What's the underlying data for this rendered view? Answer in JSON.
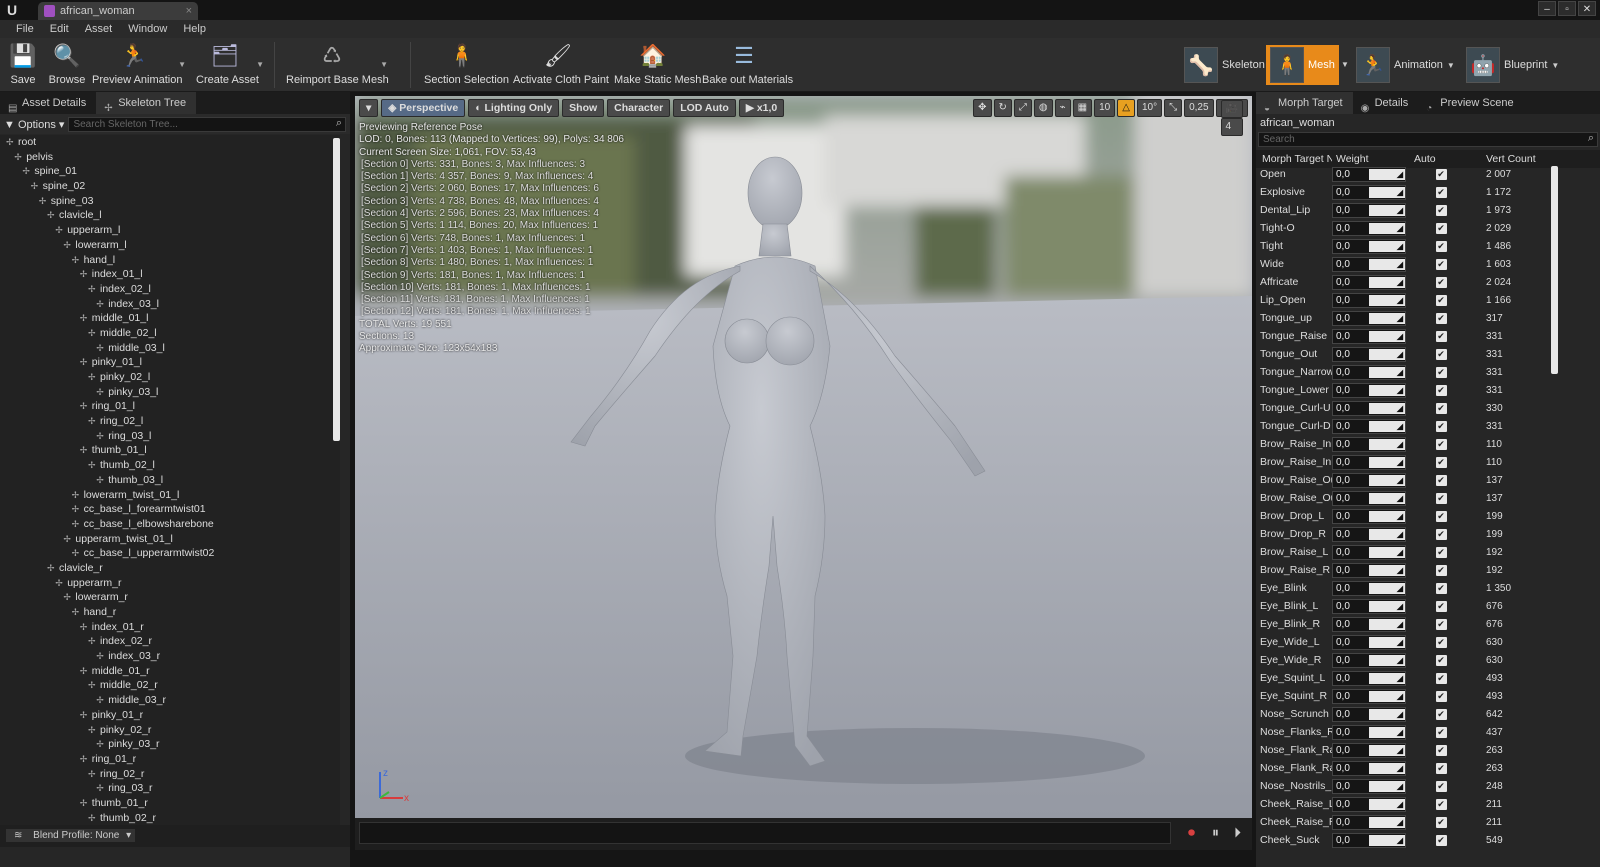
{
  "window": {
    "tab_title": "african_woman",
    "logo": "U"
  },
  "menu": [
    "File",
    "Edit",
    "Asset",
    "Window",
    "Help"
  ],
  "toolbar": {
    "save": "Save",
    "browse": "Browse",
    "preview_animation": "Preview Animation",
    "create_asset": "Create Asset",
    "reimport": "Reimport Base Mesh",
    "section_selection": "Section Selection",
    "activate_cloth": "Activate Cloth Paint",
    "make_static": "Make Static Mesh",
    "bake_materials": "Bake out Materials"
  },
  "modes": {
    "skeleton": "Skeleton",
    "mesh": "Mesh",
    "animation": "Animation",
    "blueprint": "Blueprint"
  },
  "left_panel": {
    "tab_asset_details": "Asset Details",
    "tab_skeleton_tree": "Skeleton Tree",
    "options": "Options",
    "search_placeholder": "Search Skeleton Tree...",
    "blend_profile": "Blend Profile: None",
    "bones": [
      {
        "name": "root",
        "depth": 0
      },
      {
        "name": "pelvis",
        "depth": 1
      },
      {
        "name": "spine_01",
        "depth": 2
      },
      {
        "name": "spine_02",
        "depth": 3
      },
      {
        "name": "spine_03",
        "depth": 4
      },
      {
        "name": "clavicle_l",
        "depth": 5
      },
      {
        "name": "upperarm_l",
        "depth": 6
      },
      {
        "name": "lowerarm_l",
        "depth": 7
      },
      {
        "name": "hand_l",
        "depth": 8
      },
      {
        "name": "index_01_l",
        "depth": 9
      },
      {
        "name": "index_02_l",
        "depth": 10
      },
      {
        "name": "index_03_l",
        "depth": 11
      },
      {
        "name": "middle_01_l",
        "depth": 9
      },
      {
        "name": "middle_02_l",
        "depth": 10
      },
      {
        "name": "middle_03_l",
        "depth": 11
      },
      {
        "name": "pinky_01_l",
        "depth": 9
      },
      {
        "name": "pinky_02_l",
        "depth": 10
      },
      {
        "name": "pinky_03_l",
        "depth": 11
      },
      {
        "name": "ring_01_l",
        "depth": 9
      },
      {
        "name": "ring_02_l",
        "depth": 10
      },
      {
        "name": "ring_03_l",
        "depth": 11
      },
      {
        "name": "thumb_01_l",
        "depth": 9
      },
      {
        "name": "thumb_02_l",
        "depth": 10
      },
      {
        "name": "thumb_03_l",
        "depth": 11
      },
      {
        "name": "lowerarm_twist_01_l",
        "depth": 8
      },
      {
        "name": "cc_base_l_forearmtwist01",
        "depth": 8
      },
      {
        "name": "cc_base_l_elbowsharebone",
        "depth": 8
      },
      {
        "name": "upperarm_twist_01_l",
        "depth": 7
      },
      {
        "name": "cc_base_l_upperarmtwist02",
        "depth": 8
      },
      {
        "name": "clavicle_r",
        "depth": 5
      },
      {
        "name": "upperarm_r",
        "depth": 6
      },
      {
        "name": "lowerarm_r",
        "depth": 7
      },
      {
        "name": "hand_r",
        "depth": 8
      },
      {
        "name": "index_01_r",
        "depth": 9
      },
      {
        "name": "index_02_r",
        "depth": 10
      },
      {
        "name": "index_03_r",
        "depth": 11
      },
      {
        "name": "middle_01_r",
        "depth": 9
      },
      {
        "name": "middle_02_r",
        "depth": 10
      },
      {
        "name": "middle_03_r",
        "depth": 11
      },
      {
        "name": "pinky_01_r",
        "depth": 9
      },
      {
        "name": "pinky_02_r",
        "depth": 10
      },
      {
        "name": "pinky_03_r",
        "depth": 11
      },
      {
        "name": "ring_01_r",
        "depth": 9
      },
      {
        "name": "ring_02_r",
        "depth": 10
      },
      {
        "name": "ring_03_r",
        "depth": 11
      },
      {
        "name": "thumb_01_r",
        "depth": 9
      },
      {
        "name": "thumb_02_r",
        "depth": 10
      }
    ]
  },
  "viewport": {
    "perspective": "Perspective",
    "lighting": "Lighting Only",
    "show": "Show",
    "character": "Character",
    "lod": "LOD Auto",
    "speed": "x1,0",
    "grid": "10",
    "angle": "10°",
    "scale": "0,25",
    "camspeed": "4",
    "stats": [
      "Previewing Reference Pose",
      "LOD: 0, Bones: 113 (Mapped to Vertices: 99), Polys: 34 806",
      "Current Screen Size: 1,061, FOV: 53,43",
      "[Section 0] Verts: 331, Bones: 3, Max Influences: 3",
      "[Section 1] Verts: 4 357, Bones: 9, Max Influences: 4",
      "[Section 2] Verts: 2 060, Bones: 17, Max Influences: 6",
      "[Section 3] Verts: 4 738, Bones: 48, Max Influences: 4",
      "[Section 4] Verts: 2 596, Bones: 23, Max Influences: 4",
      "[Section 5] Verts: 1 114, Bones: 20, Max Influences: 1",
      "[Section 6] Verts: 748, Bones: 1, Max Influences: 1",
      "[Section 7] Verts: 1 403, Bones: 1, Max Influences: 1",
      "[Section 8] Verts: 1 480, Bones: 1, Max Influences: 1",
      "[Section 9] Verts: 181, Bones: 1, Max Influences: 1",
      "[Section 10] Verts: 181, Bones: 1, Max Influences: 1",
      "[Section 11] Verts: 181, Bones: 1, Max Influences: 1",
      "[Section 12] Verts: 181, Bones: 1, Max Influences: 1",
      "TOTAL Verts: 19 551",
      "Sections: 13",
      "Approximate Size: 123x54x183"
    ],
    "axis_x": "x",
    "axis_z": "z"
  },
  "right_panel": {
    "tab_morph": "Morph Target",
    "tab_details": "Details",
    "tab_preview": "Preview Scene",
    "asset_name": "african_woman",
    "search_placeholder": "Search",
    "col_name": "Morph Target N",
    "col_weight": "Weight",
    "col_auto": "Auto",
    "col_vert": "Vert Count",
    "rows": [
      {
        "name": "Open",
        "weight": "0,0",
        "vc": "2 007"
      },
      {
        "name": "Explosive",
        "weight": "0,0",
        "vc": "1 172"
      },
      {
        "name": "Dental_Lip",
        "weight": "0,0",
        "vc": "1 973"
      },
      {
        "name": "Tight-O",
        "weight": "0,0",
        "vc": "2 029"
      },
      {
        "name": "Tight",
        "weight": "0,0",
        "vc": "1 486"
      },
      {
        "name": "Wide",
        "weight": "0,0",
        "vc": "1 603"
      },
      {
        "name": "Affricate",
        "weight": "0,0",
        "vc": "2 024"
      },
      {
        "name": "Lip_Open",
        "weight": "0,0",
        "vc": "1 166"
      },
      {
        "name": "Tongue_up",
        "weight": "0,0",
        "vc": "317"
      },
      {
        "name": "Tongue_Raise",
        "weight": "0,0",
        "vc": "331"
      },
      {
        "name": "Tongue_Out",
        "weight": "0,0",
        "vc": "331"
      },
      {
        "name": "Tongue_Narrow",
        "weight": "0,0",
        "vc": "331"
      },
      {
        "name": "Tongue_Lower",
        "weight": "0,0",
        "vc": "331"
      },
      {
        "name": "Tongue_Curl-U",
        "weight": "0,0",
        "vc": "330"
      },
      {
        "name": "Tongue_Curl-D",
        "weight": "0,0",
        "vc": "331"
      },
      {
        "name": "Brow_Raise_Inn",
        "weight": "0,0",
        "vc": "110"
      },
      {
        "name": "Brow_Raise_Inn",
        "weight": "0,0",
        "vc": "110"
      },
      {
        "name": "Brow_Raise_Out",
        "weight": "0,0",
        "vc": "137"
      },
      {
        "name": "Brow_Raise_Out",
        "weight": "0,0",
        "vc": "137"
      },
      {
        "name": "Brow_Drop_L",
        "weight": "0,0",
        "vc": "199"
      },
      {
        "name": "Brow_Drop_R",
        "weight": "0,0",
        "vc": "199"
      },
      {
        "name": "Brow_Raise_L",
        "weight": "0,0",
        "vc": "192"
      },
      {
        "name": "Brow_Raise_R",
        "weight": "0,0",
        "vc": "192"
      },
      {
        "name": "Eye_Blink",
        "weight": "0,0",
        "vc": "1 350"
      },
      {
        "name": "Eye_Blink_L",
        "weight": "0,0",
        "vc": "676"
      },
      {
        "name": "Eye_Blink_R",
        "weight": "0,0",
        "vc": "676"
      },
      {
        "name": "Eye_Wide_L",
        "weight": "0,0",
        "vc": "630"
      },
      {
        "name": "Eye_Wide_R",
        "weight": "0,0",
        "vc": "630"
      },
      {
        "name": "Eye_Squint_L",
        "weight": "0,0",
        "vc": "493"
      },
      {
        "name": "Eye_Squint_R",
        "weight": "0,0",
        "vc": "493"
      },
      {
        "name": "Nose_Scrunch",
        "weight": "0,0",
        "vc": "642"
      },
      {
        "name": "Nose_Flanks_Ra",
        "weight": "0,0",
        "vc": "437"
      },
      {
        "name": "Nose_Flank_Rai",
        "weight": "0,0",
        "vc": "263"
      },
      {
        "name": "Nose_Flank_Rai",
        "weight": "0,0",
        "vc": "263"
      },
      {
        "name": "Nose_Nostrils_F",
        "weight": "0,0",
        "vc": "248"
      },
      {
        "name": "Cheek_Raise_L",
        "weight": "0,0",
        "vc": "211"
      },
      {
        "name": "Cheek_Raise_R",
        "weight": "0,0",
        "vc": "211"
      },
      {
        "name": "Cheek_Suck",
        "weight": "0,0",
        "vc": "549"
      }
    ]
  }
}
